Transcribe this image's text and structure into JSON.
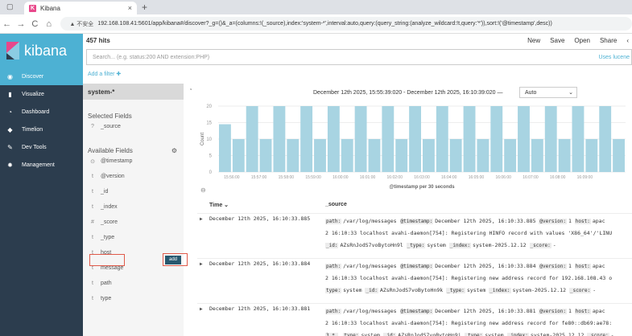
{
  "browser": {
    "tab_title": "Kibana",
    "tab_close": "×",
    "new_tab": "+",
    "back": "←",
    "forward": "→",
    "reload": "C",
    "home": "⌂",
    "security_label": "▲ 不安全",
    "url": "192.168.108.41:5601/app/kibana#/discover?_g=()&_a=(columns:!(_source),index:'system-*',interval:auto,query:(query_string:(analyze_wildcard:!t,query:'*')),sort:!('@timestamp',desc))"
  },
  "sidebar": {
    "logo_text": "kibana",
    "items": [
      {
        "label": "Discover",
        "icon": "compass-icon",
        "glyph": "◉"
      },
      {
        "label": "Visualize",
        "icon": "bar-chart-icon",
        "glyph": "▮"
      },
      {
        "label": "Dashboard",
        "icon": "dashboard-icon",
        "glyph": "◔"
      },
      {
        "label": "Timelion",
        "icon": "shield-icon",
        "glyph": "◆"
      },
      {
        "label": "Dev Tools",
        "icon": "wrench-icon",
        "glyph": "✎"
      },
      {
        "label": "Management",
        "icon": "gear-icon",
        "glyph": "✹"
      }
    ],
    "accent": "#4db1d3",
    "bg": "#2c3d4e"
  },
  "topbar": {
    "hits": "457 hits",
    "menu": [
      "New",
      "Save",
      "Open",
      "Share"
    ],
    "search_placeholder": "Search... (e.g. status:200 AND extension:PHP)",
    "uses_lucene": "Uses lucene",
    "add_filter": "Add a filter ✚"
  },
  "fields_panel": {
    "index_pattern": "system-*",
    "selected_title": "Selected Fields",
    "selected": [
      {
        "type": "?",
        "name": "_source"
      }
    ],
    "available_title": "Available Fields",
    "available": [
      {
        "type": "⊙",
        "name": "@timestamp"
      },
      {
        "type": "t",
        "name": "@version"
      },
      {
        "type": "t",
        "name": "_id"
      },
      {
        "type": "t",
        "name": "_index"
      },
      {
        "type": "#",
        "name": "_score"
      },
      {
        "type": "t",
        "name": "_type"
      },
      {
        "type": "t",
        "name": "host"
      },
      {
        "type": "t",
        "name": "message"
      },
      {
        "type": "t",
        "name": "path"
      },
      {
        "type": "t",
        "name": "type"
      }
    ],
    "add_label": "add"
  },
  "histogram": {
    "date_range": "December 12th 2025, 15:55:39:020 - December 12th 2025, 16:10:39:020 —",
    "interval": "Auto",
    "ylabel": "Count",
    "xlabel": "@timestamp per 30 seconds",
    "bar_color": "#a8d4e2"
  },
  "chart_data": {
    "type": "bar",
    "ylim": [
      0,
      20
    ],
    "yticks": [
      0,
      5,
      10,
      15,
      20
    ],
    "xticks": [
      "15:56:00",
      "15:57:00",
      "15:58:00",
      "15:59:00",
      "16:00:00",
      "16:01:00",
      "16:02:00",
      "16:03:00",
      "16:04:00",
      "16:05:00",
      "16:06:00",
      "16:07:00",
      "16:08:00",
      "16:09:00"
    ],
    "values": [
      14.5,
      10,
      20,
      10,
      20,
      10,
      20,
      10,
      20,
      10,
      20,
      10,
      20,
      10,
      20,
      10,
      20,
      10,
      20,
      10,
      20,
      10,
      20,
      10,
      20,
      10,
      20,
      10,
      20,
      10
    ],
    "xlabel": "@timestamp per 30 seconds",
    "ylabel": "Count"
  },
  "table": {
    "col_time": "Time ⌄",
    "col_source": "_source",
    "rows": [
      {
        "time": "December 12th 2025, 16:10:33.885",
        "line1": [
          [
            "path:",
            "/var/log/messages"
          ],
          [
            "@timestamp:",
            "December 12th 2025, 16:10:33.885"
          ],
          [
            "@version:",
            "1"
          ],
          [
            "host:",
            "apac"
          ]
        ],
        "line2": "2 16:10:33 localhost avahi-daemon[754]: Registering HINFO record with values 'X86_64'/'LINU",
        "line3": [
          [
            "_id:",
            "AZsRnJodS7voBytoHn9l"
          ],
          [
            "_type:",
            "system"
          ],
          [
            "_index:",
            "system-2025.12.12"
          ],
          [
            "_score:",
            "-"
          ]
        ]
      },
      {
        "time": "December 12th 2025, 16:10:33.884",
        "line1": [
          [
            "path:",
            "/var/log/messages"
          ],
          [
            "@timestamp:",
            "December 12th 2025, 16:10:33.884"
          ],
          [
            "@version:",
            "1"
          ],
          [
            "host:",
            "apac"
          ]
        ],
        "line2": "2 16:10:33 localhost avahi-daemon[754]: Registering new address record for 192.168.108.43 o",
        "line3": [
          [
            "type:",
            "system"
          ],
          [
            "_id:",
            "AZsRnJodS7voBytoHn9k"
          ],
          [
            "_type:",
            "system"
          ],
          [
            "_index:",
            "system-2025.12.12"
          ],
          [
            "_score:",
            "-"
          ]
        ]
      },
      {
        "time": "December 12th 2025, 16:10:33.881",
        "line1": [
          [
            "path:",
            "/var/log/messages"
          ],
          [
            "@timestamp:",
            "December 12th 2025, 16:10:33.881"
          ],
          [
            "@version:",
            "1"
          ],
          [
            "host:",
            "apac"
          ]
        ],
        "line2": "2 16:10:33 localhost avahi-daemon[754]: Registering new address record for fe80::db69:ae78:",
        "line3": [
          [
            "3.*.",
            ""
          ],
          [
            "type:",
            "system"
          ],
          [
            "_id:",
            "AZsRnJodS7voBytoHn9j"
          ],
          [
            "_type:",
            "system"
          ],
          [
            "_index:",
            "system-2025.12.12"
          ],
          [
            "_score:",
            "-"
          ]
        ]
      }
    ]
  }
}
